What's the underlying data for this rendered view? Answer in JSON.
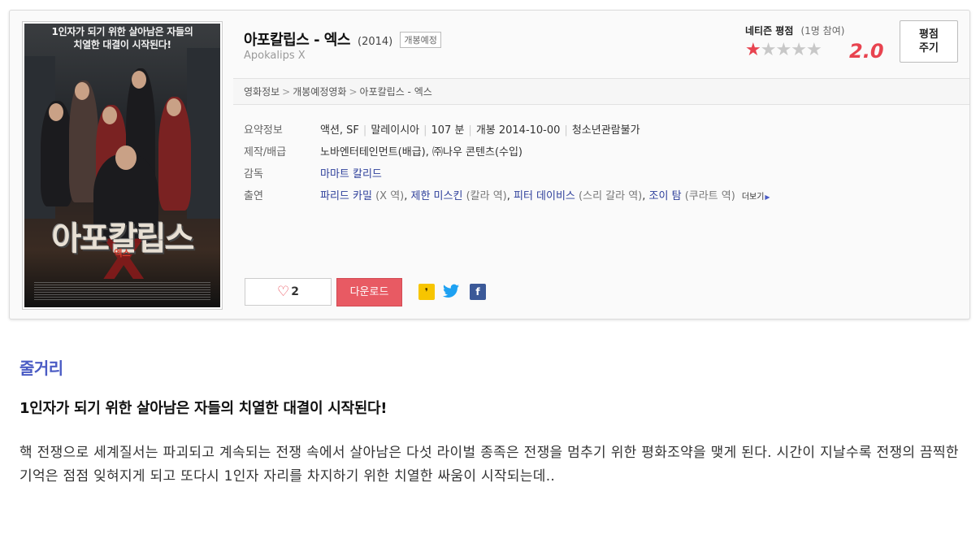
{
  "movie": {
    "title": "아포칼립스 - 엑스",
    "year": "(2014)",
    "status_badge": "개봉예정",
    "english_title": "Apokalips X"
  },
  "poster": {
    "tagline": "1인자가 되기 위한 살아남은 자들의\n치열한 대결이 시작된다!",
    "title_art": "아포칼립스",
    "title_x": "X",
    "subtitle_art": "엑스"
  },
  "rating": {
    "label": "네티즌 평점",
    "count": "(1명 참여)",
    "score": "2.0",
    "stars_filled": 1,
    "stars_total": 5,
    "button_label": "평점\n주기"
  },
  "breadcrumb": [
    "영화정보",
    "개봉예정영화",
    "아포칼립스 - 엑스"
  ],
  "info": {
    "summary_label": "요약정보",
    "summary": [
      "액션, SF",
      "말레이시아",
      "107 분",
      "개봉 2014-10-00",
      "청소년관람불가"
    ],
    "production_label": "제작/배급",
    "production": "노바엔터테인먼트(배급), ㈜나우 콘텐츠(수입)",
    "director_label": "감독",
    "director": "마마트 칼리드",
    "cast_label": "출연",
    "cast": [
      {
        "name": "파리드 카밀",
        "role": "(X 역)"
      },
      {
        "name": "제한 미스킨",
        "role": "(칼라 역)"
      },
      {
        "name": "피터 데이비스",
        "role": "(스리 갈라 역)"
      },
      {
        "name": "조이 탐",
        "role": "(쿠라트 역)"
      }
    ],
    "more_label": "더보기"
  },
  "actions": {
    "like_count": "2",
    "download_label": "다운로드"
  },
  "synopsis": {
    "section_title": "줄거리",
    "tagline": "1인자가 되기 위한 살아남은 자들의 치열한 대결이 시작된다!",
    "text": "핵 전쟁으로 세계질서는 파괴되고 계속되는 전쟁 속에서 살아남은 다섯 라이벌 종족은 전쟁을 멈추기 위한 평화조약을 맺게 된다. 시간이 지날수록 전쟁의 끔찍한 기억은 점점 잊혀지게 되고 또다시 1인자 자리를 차지하기 위한 치열한 싸움이 시작되는데.."
  },
  "colors": {
    "accent_red": "#e8434f",
    "link_blue": "#2d3f9b",
    "section_blue": "#4a5bc4",
    "download_bg": "#e85a63"
  }
}
